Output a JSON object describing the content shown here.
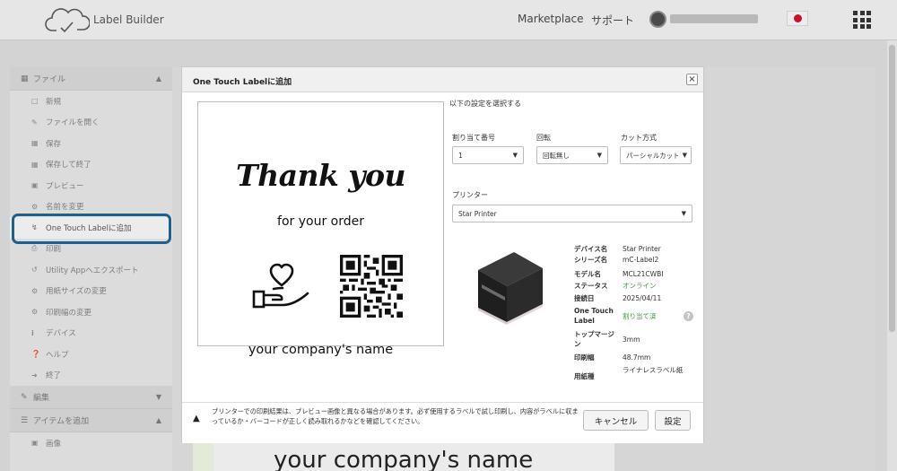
{
  "app": {
    "title": "Label Builder"
  },
  "header": {
    "marketplace": "Marketplace",
    "support": "サポート"
  },
  "sidebar": {
    "file_section": "ファイル",
    "file_items": [
      {
        "label": "新規",
        "icon": "file-icon"
      },
      {
        "label": "ファイルを開く",
        "icon": "edit-icon"
      },
      {
        "label": "保存",
        "icon": "save-icon"
      },
      {
        "label": "保存して終了",
        "icon": "save-icon"
      },
      {
        "label": "プレビュー",
        "icon": "image-icon"
      },
      {
        "label": "名前を変更",
        "icon": "gear-icon"
      },
      {
        "label": "One Touch Labelに追加",
        "icon": "bolt-icon"
      },
      {
        "label": "印刷",
        "icon": "print-icon"
      },
      {
        "label": "Utility Appへエクスポート",
        "icon": "share-icon"
      },
      {
        "label": "用紙サイズの変更",
        "icon": "gears-icon"
      },
      {
        "label": "印刷幅の変更",
        "icon": "gears-icon"
      },
      {
        "label": "デバイス",
        "icon": "info-icon"
      },
      {
        "label": "ヘルプ",
        "icon": "help-icon"
      },
      {
        "label": "終了",
        "icon": "exit-icon"
      }
    ],
    "edit_section": "編集",
    "add_section": "アイテムを追加",
    "add_items": [
      {
        "label": "画像",
        "icon": "image-icon"
      }
    ]
  },
  "canvas": {
    "visible_text": "your company's name"
  },
  "modal": {
    "title": "One Touch Labelに追加",
    "settings_label": "以下の設定を選択する",
    "assign_label": "割り当て番号",
    "assign_value": "1",
    "rotate_label": "回転",
    "rotate_value": "回転無し",
    "cut_label": "カット方式",
    "cut_value": "パーシャルカット",
    "printer_label": "プリンター",
    "printer_value": "Star Printer",
    "preview": {
      "thank": "Thank you",
      "order": "for your order",
      "company": "your company's name"
    },
    "device_info": [
      {
        "label": "デバイス名",
        "value": "Star Printer",
        "status": "normal"
      },
      {
        "label": "シリーズ名",
        "value": "mC-Label2",
        "status": "normal"
      },
      {
        "label": "モデル名",
        "value": "MCL21CWBI",
        "status": "normal"
      },
      {
        "label": "ステータス",
        "value": "オンライン",
        "status": "ok"
      },
      {
        "label": "接続日",
        "value": "2025/04/11",
        "status": "normal"
      },
      {
        "label": "One Touch Label",
        "value": "割り当て済",
        "status": "ok"
      },
      {
        "label": "トップマージン",
        "value": "3mm",
        "status": "normal"
      },
      {
        "label": "印刷幅",
        "value": "48.7mm",
        "status": "normal"
      },
      {
        "label": "用紙種",
        "value": "ライナレスラベル紙",
        "status": "normal"
      }
    ],
    "warning": "プリンターでの印刷結果は、プレビュー画像と異なる場合があります。必ず使用するラベルで試し印刷し、内容がラベルに収まっているか・バーコードが正しく読み取れるかなどを確認してください。",
    "cancel": "キャンセル",
    "confirm": "設定"
  },
  "colors": {
    "highlight": "#1d5f8f",
    "status_ok": "#3c9a3c",
    "flag_red": "#c8102e"
  }
}
